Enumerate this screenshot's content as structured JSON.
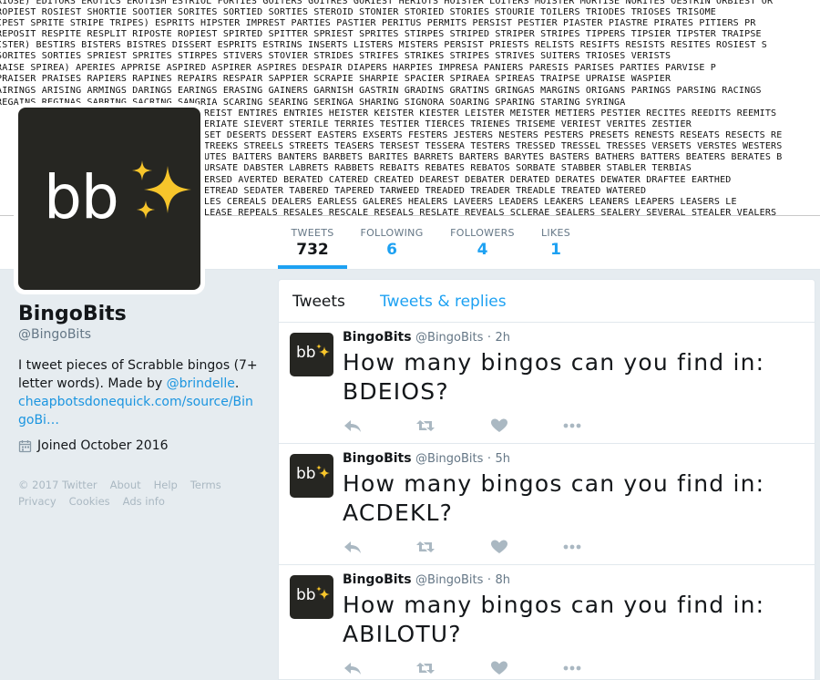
{
  "banner": {
    "lines": [
      "RIOSE) EDITORS EROTICS EROTISM ESTRIOL FORTIES GOITERS GOITRES GORIEST HERIOTS HOISTER LOITERS MOISTER MORTISE NORITES OESTRIN ORBIEST OR",
      "ROPIEST ROSIEST SHORTIE SOOTIER SORITES SORTIED SORTIES STEROID STONIER STORIED STORIES STOURIE TOILERS TRIODES TRIOSES TRISOME",
      "IPEST SPRITE STRIPE TRIPES)   ESPRITS HIPSTER IMPREST PARTIES PASTIER PERITUS PERMITS PERSIST PESTIER PIASTER PIASTRE PIRATES PITIERS PR",
      "REPOSIT RESPITE RESPLIT RIPOSTE ROPIEST SPIRTED SPITTER SPRIEST SPRITES STIRPES STRIPED STRIPER STRIPES TIPPERS TIPSIER TIPSTER TRAIPSE",
      "ISTER) BESTIRS BISTERS BISTRES DISSERT ESPRITS ESTRINS INSERTS LISTERS MISTERS PERSIST PRIESTS RELISTS RESIFTS RESISTS RESITES ROSIEST S",
      "SORITES SORTIES SPRIEST SPRITES STIRPES STIVERS STOVIER STRIDES STRIFES STRIKES STRIPES STRIVES SUITERS TRIOSES VERISTS",
      "RAISE SPIREA)  APERIES APPRISE ASPIRED ASPIRER ASPIRES DESPAIR DIAPERS HARPIES IMPRESA PANIERS PARESIS PARISES PARTIES PARVISE P",
      "PRAISER PRAISES RAPIERS RAPINES REPAIRS RESPAIR SAPPIER SCRAPIE SHARPIE SPACIER SPIRAEA SPIREAS TRAIPSE UPRAISE WASPIER",
      "AIRINGS ARISING ARMINGS DARINGS EARINGS ERASING GAINERS GARNISH GASTRIN GRADINS GRATINS GRINGAS MARGINS ORIGANS PARINGS PARSING RACINGS",
      "REGAINS REGINAS SABRING SACRING SANGRIA SCARING SEARING SERINGA SHARING SIGNORA SOARING SPARING STARING SYRINGA",
      "REIST ENTIRES ENTRIES HEISTER KEISTER KIESTER LEISTER MEISTER METIERS PESTIER RECITES REEDITS REEMITS",
      "ERIATE SIEVERT STERILE TERRIES TESTIER TIERCES TRIENES TRISEME VERIEST VERITES ZESTIER",
      "SET DESERTS DESSERT EASTERS EXSERTS FESTERS JESTERS NESTERS PESTERS PRESETS RENESTS RESEATS RESECTS RE",
      "TREEKS STREELS STREETS TEASERS TERSEST TESSERA TESTERS TRESSED TRESSEL TRESSES VERSETS VERSTES WESTERS",
      "UTES BAITERS BANTERS BARBETS BARITES BARRETS BARTERS BARYTES BASTERS BATHERS BATTERS BEATERS BERATES B",
      "URSATE DABSTER LABRETS RABBETS REBAITS REBATES REBATOS SORBATE STABBER STABLER TERBIAS",
      "ERSED AVERTED BERATED CATERED CREATED DEAREST DEBATER DERATED DERATES DEWATER DRAFTEE EARTHED",
      "ETREAD SEDATER TABERED TAPERED TARWEED TREADED TREADER TREADLE TREATED WATERED",
      "LES CEREALS DEALERS EARLESS GALERES HEALERS LAVEERS LEADERS LEAKERS LEANERS LEAPERS LEASERS LE",
      "LEASE REPEALS RESALES RESCALE RESEALS RESLATE REVEALS SCLERAE SEALERS SEALERY SEVERAL STEALER VEALERS"
    ]
  },
  "profile": {
    "avatar_text": "bb",
    "name": "BingoBits",
    "handle": "@BingoBits",
    "bio_prefix": "I tweet pieces of Scrabble bingos (7+ letter words). Made by ",
    "bio_mention": "@brindelle",
    "bio_suffix": ".",
    "link": "cheapbotsdonequick.com/source/BingoBi…",
    "joined": "Joined October 2016"
  },
  "nav": {
    "stats": [
      {
        "label": "TWEETS",
        "value": "732"
      },
      {
        "label": "FOLLOWING",
        "value": "6"
      },
      {
        "label": "FOLLOWERS",
        "value": "4"
      },
      {
        "label": "LIKES",
        "value": "1"
      }
    ]
  },
  "footer": {
    "links": [
      "© 2017 Twitter",
      "About",
      "Help",
      "Terms",
      "Privacy",
      "Cookies",
      "Ads info"
    ]
  },
  "timeline": {
    "tabs": [
      "Tweets",
      "Tweets & replies"
    ],
    "tweets": [
      {
        "name": "BingoBits",
        "handle": "@BingoBits",
        "dot": "·",
        "time": "2h",
        "text": "How many bingos can you find in: BDEIOS?"
      },
      {
        "name": "BingoBits",
        "handle": "@BingoBits",
        "dot": "·",
        "time": "5h",
        "text": "How many bingos can you find in: ACDEKL?"
      },
      {
        "name": "BingoBits",
        "handle": "@BingoBits",
        "dot": "·",
        "time": "8h",
        "text": "How many bingos can you find in: ABILOTU?"
      }
    ]
  },
  "colors": {
    "accent": "#1da1f2",
    "background": "#e6ecf0",
    "avatar_bg": "#262622",
    "sparkle": "#f7c52b"
  },
  "icons": [
    "sparkles-icon",
    "calendar-icon",
    "reply-icon",
    "retweet-icon",
    "like-icon",
    "more-icon"
  ]
}
